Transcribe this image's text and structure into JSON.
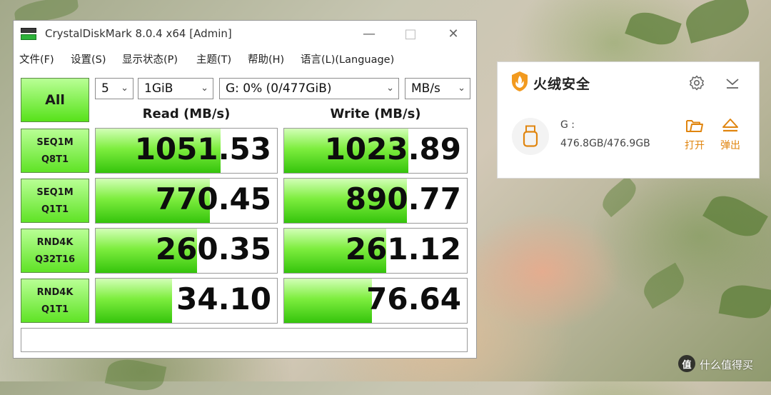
{
  "cdm": {
    "title": "CrystalDiskMark 8.0.4 x64 [Admin]",
    "menu": [
      "文件(F)",
      "设置(S)",
      "显示状态(P)",
      "主题(T)",
      "帮助(H)",
      "语言(L)(Language)"
    ],
    "all_label": "All",
    "count": "5",
    "size": "1GiB",
    "drive": "G: 0% (0/477GiB)",
    "unit": "MB/s",
    "read_header": "Read (MB/s)",
    "write_header": "Write (MB/s)",
    "rows": [
      {
        "l1": "SEQ1M",
        "l2": "Q8T1",
        "read": "1051.53",
        "write": "1023.89",
        "read_fill": 0.69,
        "write_fill": 0.68
      },
      {
        "l1": "SEQ1M",
        "l2": "Q1T1",
        "read": "770.45",
        "write": "890.77",
        "read_fill": 0.63,
        "write_fill": 0.67
      },
      {
        "l1": "RND4K",
        "l2": "Q32T16",
        "read": "260.35",
        "write": "261.12",
        "read_fill": 0.56,
        "write_fill": 0.56
      },
      {
        "l1": "RND4K",
        "l2": "Q1T1",
        "read": "34.10",
        "write": "76.64",
        "read_fill": 0.42,
        "write_fill": 0.48
      }
    ]
  },
  "huorong": {
    "title": "火绒安全",
    "drive": "G :",
    "capacity": "476.8GB/476.9GB",
    "open_label": "打开",
    "eject_label": "弹出",
    "accent": "#e0850f"
  },
  "watermark": {
    "text": "什么值得买",
    "logo_text": "值"
  }
}
